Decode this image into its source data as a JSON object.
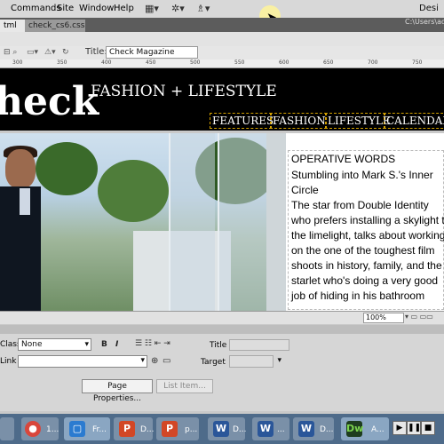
{
  "menu": {
    "items": [
      "Commands",
      "Site",
      "Window",
      "Help"
    ],
    "right_label": "Desi"
  },
  "tabs": {
    "active": "tml",
    "second": "check_cs6.css",
    "path": "C:\\Users\\adm"
  },
  "doc_toolbar": {
    "title_label": "Title:",
    "title_value": "Check Magazine"
  },
  "ruler": {
    "ticks": [
      "300",
      "350",
      "400",
      "450",
      "500",
      "550",
      "600",
      "650",
      "700",
      "750"
    ]
  },
  "page": {
    "logo": "heck",
    "tagline": "FASHION + LIFESTYLE",
    "nav": [
      "FEATURES",
      "FASHION",
      "LIFESTYLE",
      "CALENDAR"
    ],
    "side_heading": "OPERATIVE WORDS",
    "side_subheading": "Stumbling into Mark S.'s Inner Circle",
    "side_body": "The star from Double Identity who prefers installing a skylight to the limelight, talks about working on the one of the toughest film shoots in history, family, and the starlet who's doing a very good job of hiding in his bathroom"
  },
  "status": {
    "zoom": "100%"
  },
  "properties": {
    "class_label": "Class",
    "class_value": "None",
    "link_label": "Link",
    "bold": "B",
    "italic": "I",
    "title_label": "Title",
    "target_label": "Target",
    "page_properties_button": "Page Properties...",
    "list_item_button": "List Item..."
  },
  "taskbar": {
    "apps": [
      {
        "name": "chrome-icon",
        "label": "1..."
      },
      {
        "name": "camera-icon",
        "label": "Fr..."
      },
      {
        "name": "powerpoint-icon",
        "label": "D..."
      },
      {
        "name": "powerpoint-icon",
        "label": "p..."
      },
      {
        "name": "word-icon",
        "label": "D..."
      },
      {
        "name": "word-icon",
        "label": "..."
      },
      {
        "name": "word-icon",
        "label": "D..."
      },
      {
        "name": "dreamweaver-icon",
        "label": "A..."
      }
    ]
  }
}
